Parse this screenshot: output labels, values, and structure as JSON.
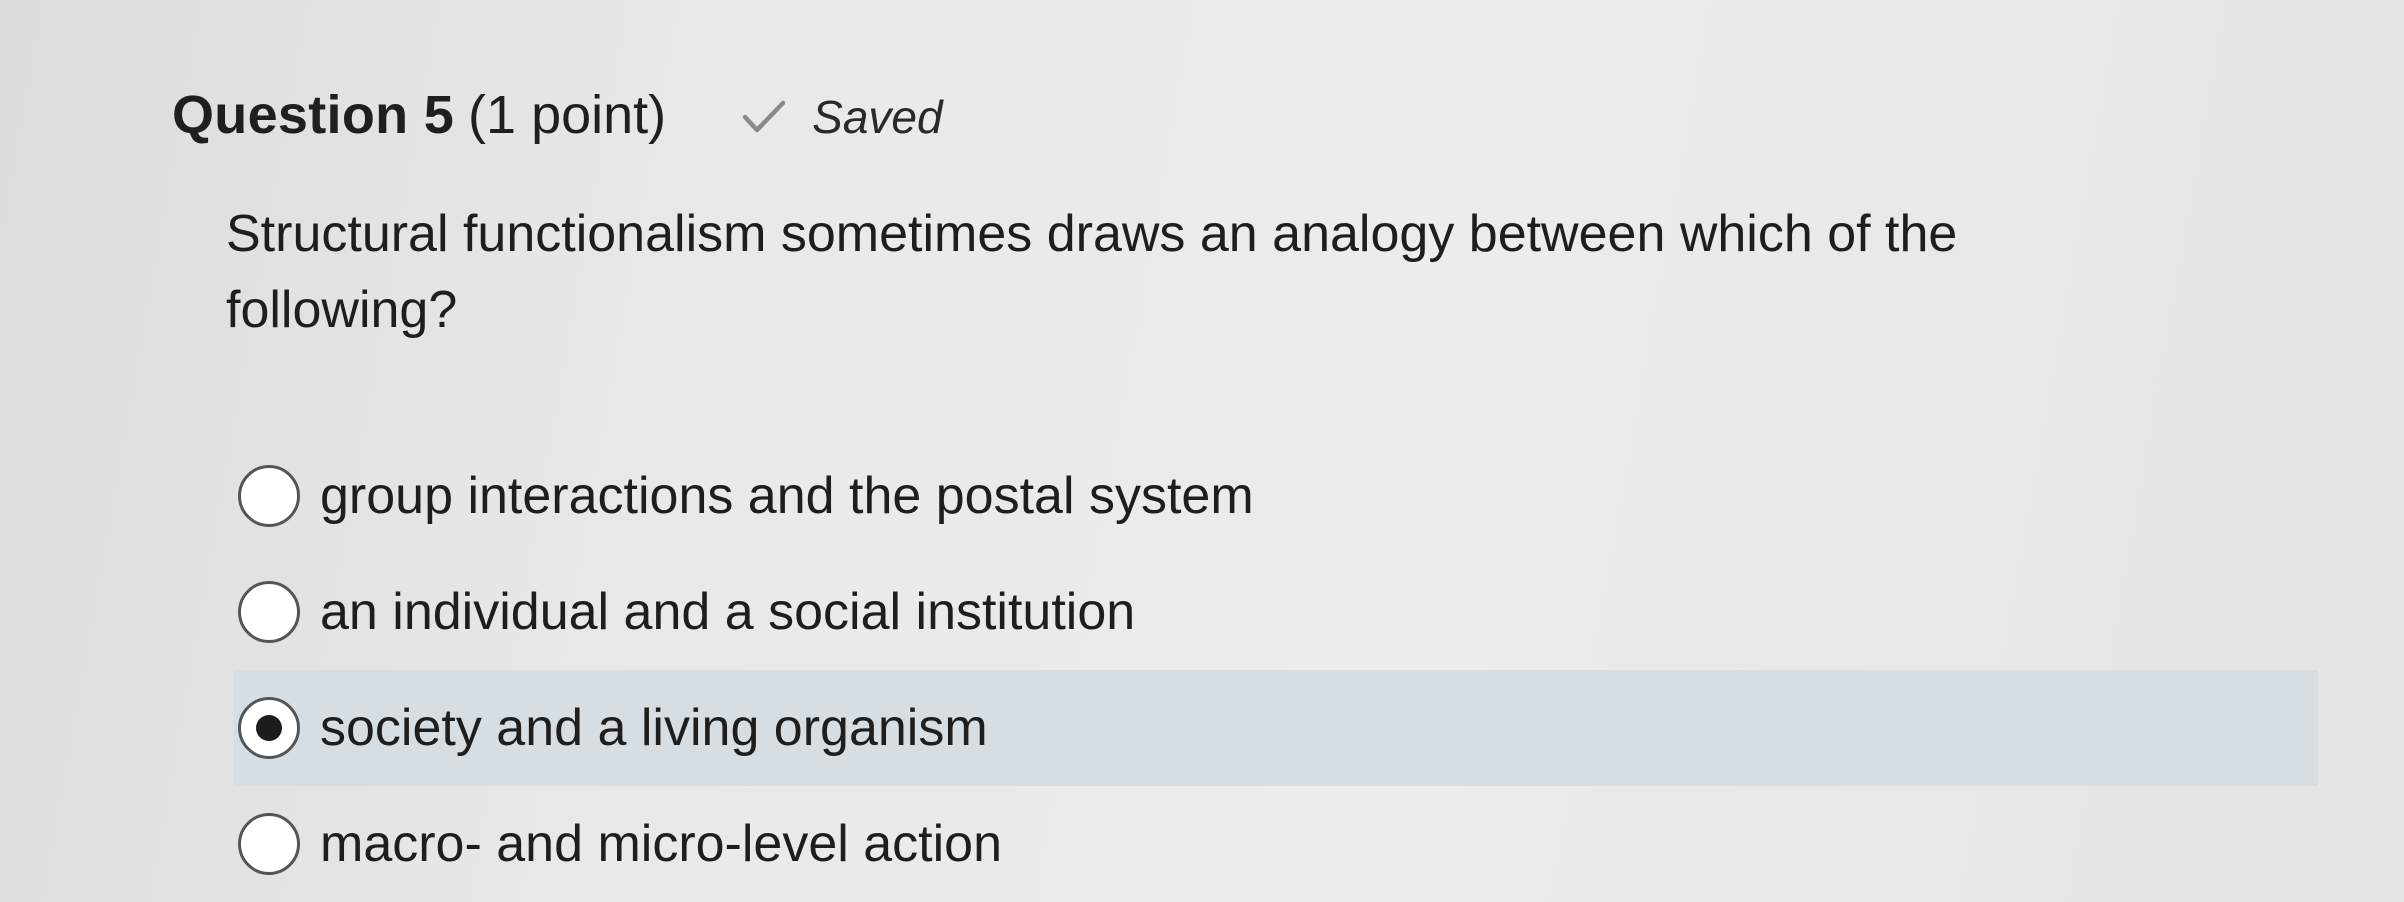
{
  "question": {
    "title": "Question 5",
    "points": "(1 point)",
    "status_label": "Saved",
    "status_icon": "check-icon",
    "text": "Structural functionalism sometimes draws an analogy between which of the following?"
  },
  "options": [
    {
      "label": "group interactions and the postal system",
      "selected": false
    },
    {
      "label": "an individual and a social institution",
      "selected": false
    },
    {
      "label": "society and a living organism",
      "selected": true
    },
    {
      "label": "macro- and micro-level action",
      "selected": false
    }
  ],
  "colors": {
    "selected_background": "#d7dee3",
    "radio_border": "#555555",
    "check_icon": "#8a8a8a"
  }
}
